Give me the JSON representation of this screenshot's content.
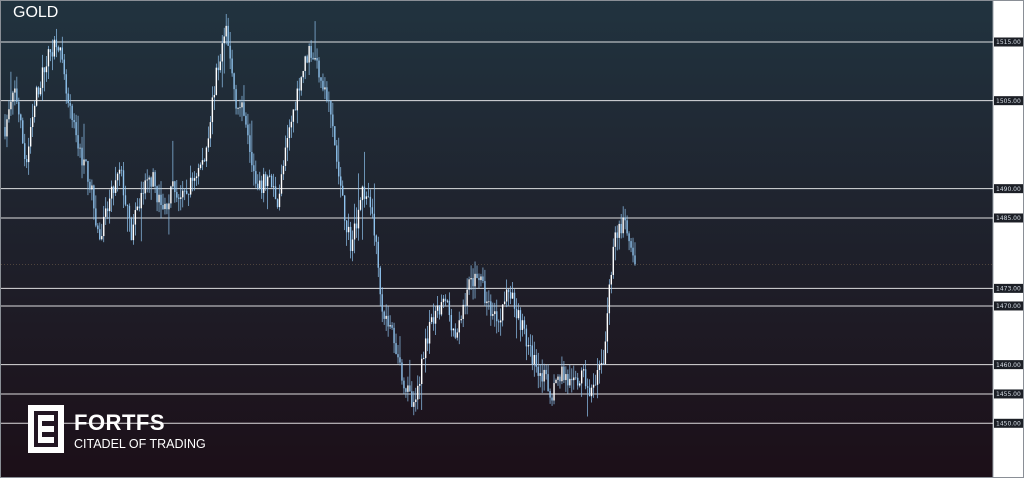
{
  "chart_data": {
    "type": "candlestick",
    "symbol": "GOLD",
    "ylim": [
      1446,
      1520
    ],
    "levels": [
      1515.0,
      1505.0,
      1490.0,
      1485.0,
      1473.0,
      1470.0,
      1460.0,
      1455.0,
      1450.0
    ],
    "level_labels": [
      "1515.00",
      "1505.00",
      "1490.00",
      "1485.00",
      "1473.00",
      "1470.00",
      "1460.00",
      "1455.00",
      "1450.00"
    ],
    "last_price": 1477.1,
    "price_path": [
      1500.5,
      1507,
      1494,
      1506,
      1512,
      1516,
      1504,
      1497,
      1492,
      1481,
      1488,
      1493,
      1482,
      1489,
      1492,
      1486,
      1490,
      1488,
      1492,
      1495,
      1508,
      1517,
      1505,
      1502,
      1489,
      1492,
      1488,
      1499,
      1508,
      1514,
      1510,
      1503,
      1489,
      1480,
      1490,
      1486,
      1469,
      1465,
      1457,
      1452,
      1464,
      1468,
      1471,
      1464,
      1473,
      1476,
      1470,
      1468,
      1473,
      1468,
      1462,
      1459,
      1455,
      1459,
      1456,
      1458,
      1455,
      1461,
      1482,
      1484,
      1476
    ],
    "colors": {
      "line": "#8fc3ee",
      "bg_top": "#21333f",
      "bg_bottom": "#1c0f18",
      "level": "#ffffff"
    }
  },
  "branding": {
    "name": "FORTFS",
    "tagline": "CITADEL OF TRADING"
  }
}
